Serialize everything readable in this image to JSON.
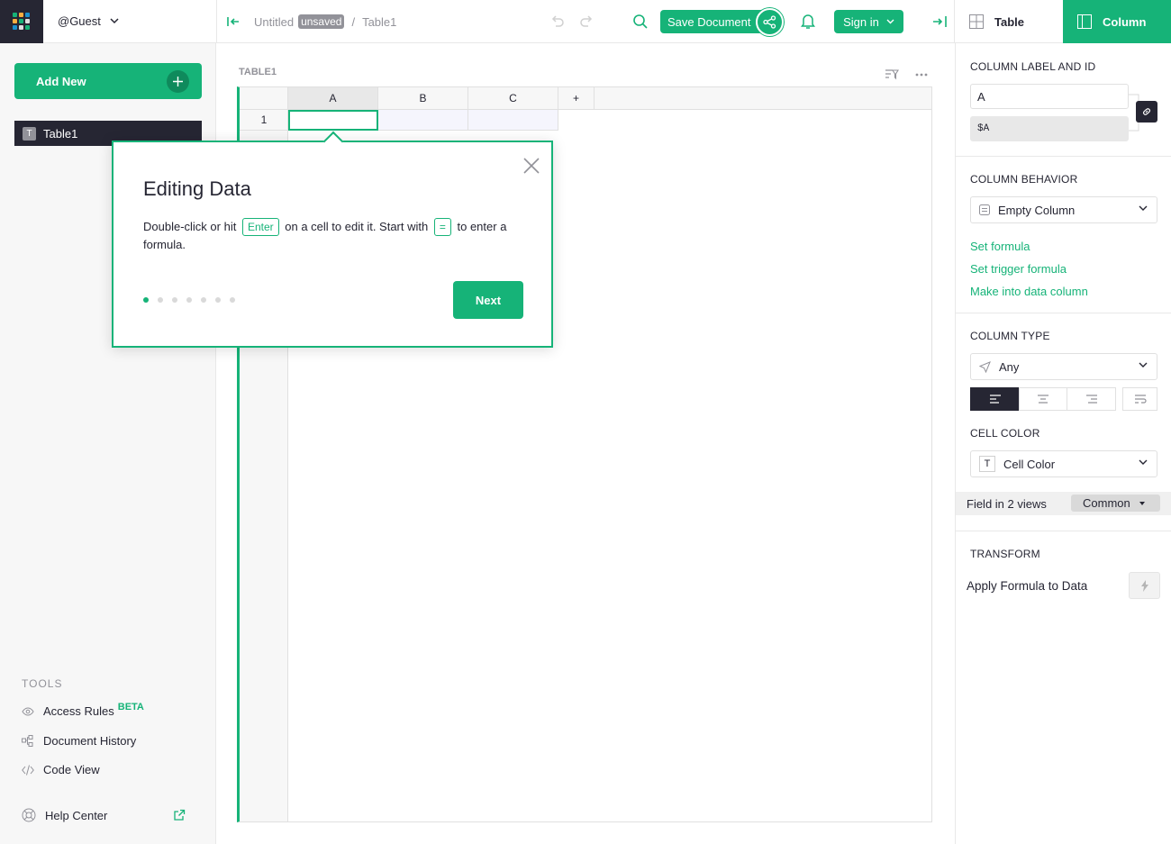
{
  "topbar": {
    "org": "@Guest",
    "doc_title": "Untitled",
    "unsaved": "unsaved",
    "separator": "/",
    "page_name": "Table1",
    "save_label": "Save Document",
    "signin_label": "Sign in",
    "tab_table": "Table",
    "tab_column": "Column"
  },
  "sidebar": {
    "add_new": "Add New",
    "pages": [
      {
        "label": "Table1",
        "icon": "T"
      }
    ],
    "tools_title": "TOOLS",
    "tools": [
      {
        "label": "Access Rules",
        "badge": "BETA",
        "icon": "eye-icon"
      },
      {
        "label": "Document History",
        "icon": "history-icon"
      },
      {
        "label": "Code View",
        "icon": "code-icon"
      }
    ],
    "help": "Help Center"
  },
  "main": {
    "section_title": "TABLE1",
    "columns": [
      "A",
      "B",
      "C"
    ],
    "add_column": "+",
    "rows": [
      "1"
    ]
  },
  "popup": {
    "title": "Editing Data",
    "text1": "Double-click or hit",
    "key1": "Enter",
    "text2": "on a cell to edit it. Start with",
    "key2": "=",
    "text3": "to enter a formula.",
    "next_label": "Next",
    "pages_total": 7,
    "current_page": 1
  },
  "rightpanel": {
    "col_label_title": "COLUMN LABEL AND ID",
    "col_label_value": "A",
    "col_id_value": "$A",
    "behavior_title": "COLUMN BEHAVIOR",
    "behavior_value": "Empty Column",
    "links": [
      "Set formula",
      "Set trigger formula",
      "Make into data column"
    ],
    "type_title": "COLUMN TYPE",
    "type_value": "Any",
    "cell_color_title": "CELL COLOR",
    "cell_color_value": "Cell Color",
    "cell_color_icon": "T",
    "field_in_views": "Field in 2 views",
    "common": "Common",
    "transform_title": "TRANSFORM",
    "apply_formula": "Apply Formula to Data"
  },
  "colors": {
    "accent": "#16b378",
    "dark": "#262633",
    "muted": "#929299"
  }
}
